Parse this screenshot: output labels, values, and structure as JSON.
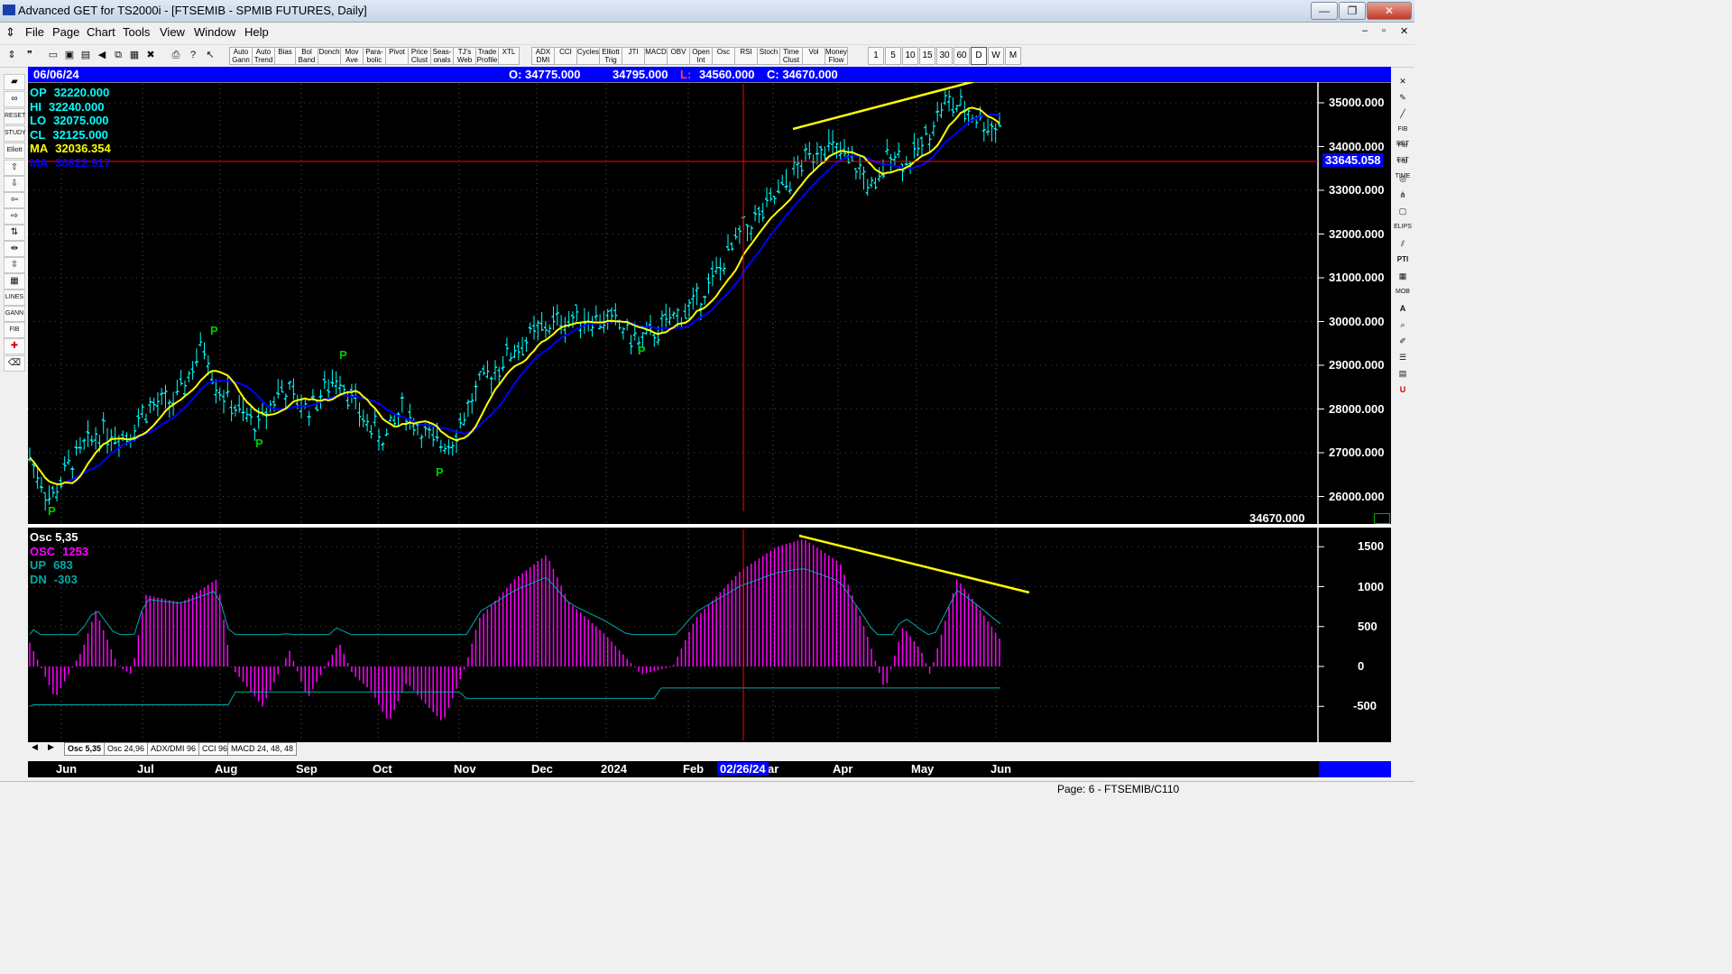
{
  "window": {
    "title": "Advanced GET for TS2000i - [FTSEMIB - SPMIB FUTURES, Daily]"
  },
  "menu": [
    "File",
    "Page",
    "Chart",
    "Tools",
    "View",
    "Window",
    "Help"
  ],
  "toolbar": {
    "study_buttons": [
      "Auto Gann",
      "Auto Trend",
      "Bias",
      "Bol Band",
      "Donch",
      "Mov Ave",
      "Para-bolic",
      "Pivot",
      "Price Clust",
      "Seas-onals",
      "TJ's Web",
      "Trade Profile",
      "XTL",
      "ADX DMI",
      "CCI",
      "Cycles",
      "Elliott Trig",
      "JTI",
      "MACD",
      "OBV",
      "Open Int",
      "Osc",
      "RSI",
      "Stoch",
      "Time Clust",
      "Vol",
      "Money Flow"
    ],
    "interval_buttons": [
      "1",
      "5",
      "10",
      "15",
      "30",
      "60",
      "D",
      "W",
      "M"
    ]
  },
  "infobar": {
    "date": "06/06/24",
    "open": "O: 34775.000",
    "high": "34795.000",
    "low_label": "L:",
    "low": "34560.000",
    "close": "C: 34670.000"
  },
  "price_panel": {
    "readouts": [
      {
        "label": "OP",
        "value": "32220.000",
        "color": "#00ffff"
      },
      {
        "label": "HI",
        "value": "32240.000",
        "color": "#00ffff"
      },
      {
        "label": "LO",
        "value": "32075.000",
        "color": "#00ffff"
      },
      {
        "label": "CL",
        "value": "32125.000",
        "color": "#00ffff"
      },
      {
        "label": "MA",
        "value": "32036.354",
        "color": "#ffff00"
      },
      {
        "label": "MA",
        "value": "30822.917",
        "color": "#0000ff"
      }
    ],
    "axis_labels": [
      "35000.000",
      "34000.000",
      "33000.000",
      "32000.000",
      "31000.000",
      "30000.000",
      "29000.000",
      "28000.000",
      "27000.000",
      "26000.000"
    ],
    "cursor_price": "33645.058",
    "last_price": "34670.000",
    "pivot_marker": "P"
  },
  "osc_panel": {
    "readouts": [
      {
        "label": "Osc 5,35",
        "value": "",
        "color": "#ffffff"
      },
      {
        "label": "OSC",
        "value": "1253",
        "color": "#ff00ff"
      },
      {
        "label": "UP",
        "value": "683",
        "color": "#00aaaa"
      },
      {
        "label": "DN",
        "value": "-303",
        "color": "#00aaaa"
      }
    ],
    "axis_labels": [
      "1500",
      "1000",
      "500",
      "0",
      "-500"
    ]
  },
  "tabs": [
    "Osc 5,35",
    "Osc 24,96",
    "ADX/DMI 96",
    "CCI 96",
    "MACD 24, 48, 48"
  ],
  "time_axis": {
    "months": [
      "Jun",
      "Jul",
      "Aug",
      "Sep",
      "Oct",
      "Nov",
      "Dec",
      "2024",
      "Feb",
      "ar",
      "Apr",
      "May",
      "Jun"
    ],
    "cursor_date": "02/26/24"
  },
  "status": {
    "page": "Page: 6 - FTSEMIB/C110"
  },
  "colors": {
    "background": "#000000",
    "price_bar": "#00ffff",
    "ma_fast": "#ffff00",
    "ma_slow": "#0000ff",
    "osc": "#ff00ff",
    "bands": "#00aaaa",
    "cursor": "#ff0000",
    "trendline": "#ffff00",
    "pivot": "#00cc00",
    "infobar": "#0000ff"
  }
}
